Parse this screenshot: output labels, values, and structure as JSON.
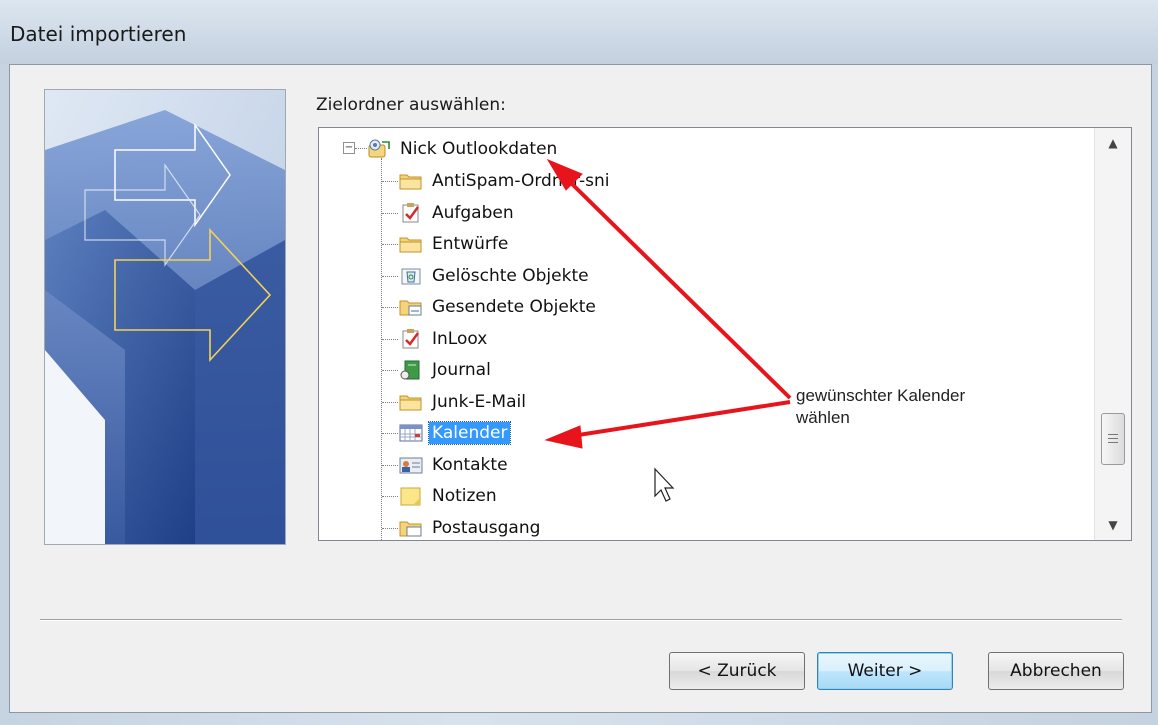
{
  "window": {
    "title": "Datei importieren"
  },
  "dialog": {
    "prompt": "Zielordner auswählen:"
  },
  "tree": {
    "root": {
      "label": "Nick Outlookdaten",
      "icon": "outlook-data-file-icon",
      "expander": "−"
    },
    "items": [
      {
        "label": "AntiSpam-Ordner-sni",
        "icon": "folder-icon"
      },
      {
        "label": "Aufgaben",
        "icon": "tasks-icon"
      },
      {
        "label": "Entwürfe",
        "icon": "folder-icon"
      },
      {
        "label": "Gelöschte Objekte",
        "icon": "deleted-items-icon"
      },
      {
        "label": "Gesendete Objekte",
        "icon": "sent-items-icon"
      },
      {
        "label": "InLoox",
        "icon": "tasks-icon"
      },
      {
        "label": "Journal",
        "icon": "journal-icon"
      },
      {
        "label": "Junk-E-Mail",
        "icon": "folder-icon"
      },
      {
        "label": "Kalender",
        "icon": "calendar-icon",
        "selected": true
      },
      {
        "label": "Kontakte",
        "icon": "contacts-icon"
      },
      {
        "label": "Notizen",
        "icon": "notes-icon"
      },
      {
        "label": "Postausgang",
        "icon": "outbox-icon"
      }
    ]
  },
  "annotation": {
    "line1": "gewünschter Kalender",
    "line2": "wählen",
    "arrow_color": "#e8141c"
  },
  "buttons": {
    "back": "< Zurück",
    "next": "Weiter >",
    "cancel": "Abbrechen"
  },
  "colors": {
    "selection": "#3399ff",
    "annotation_arrow": "#e8141c"
  }
}
